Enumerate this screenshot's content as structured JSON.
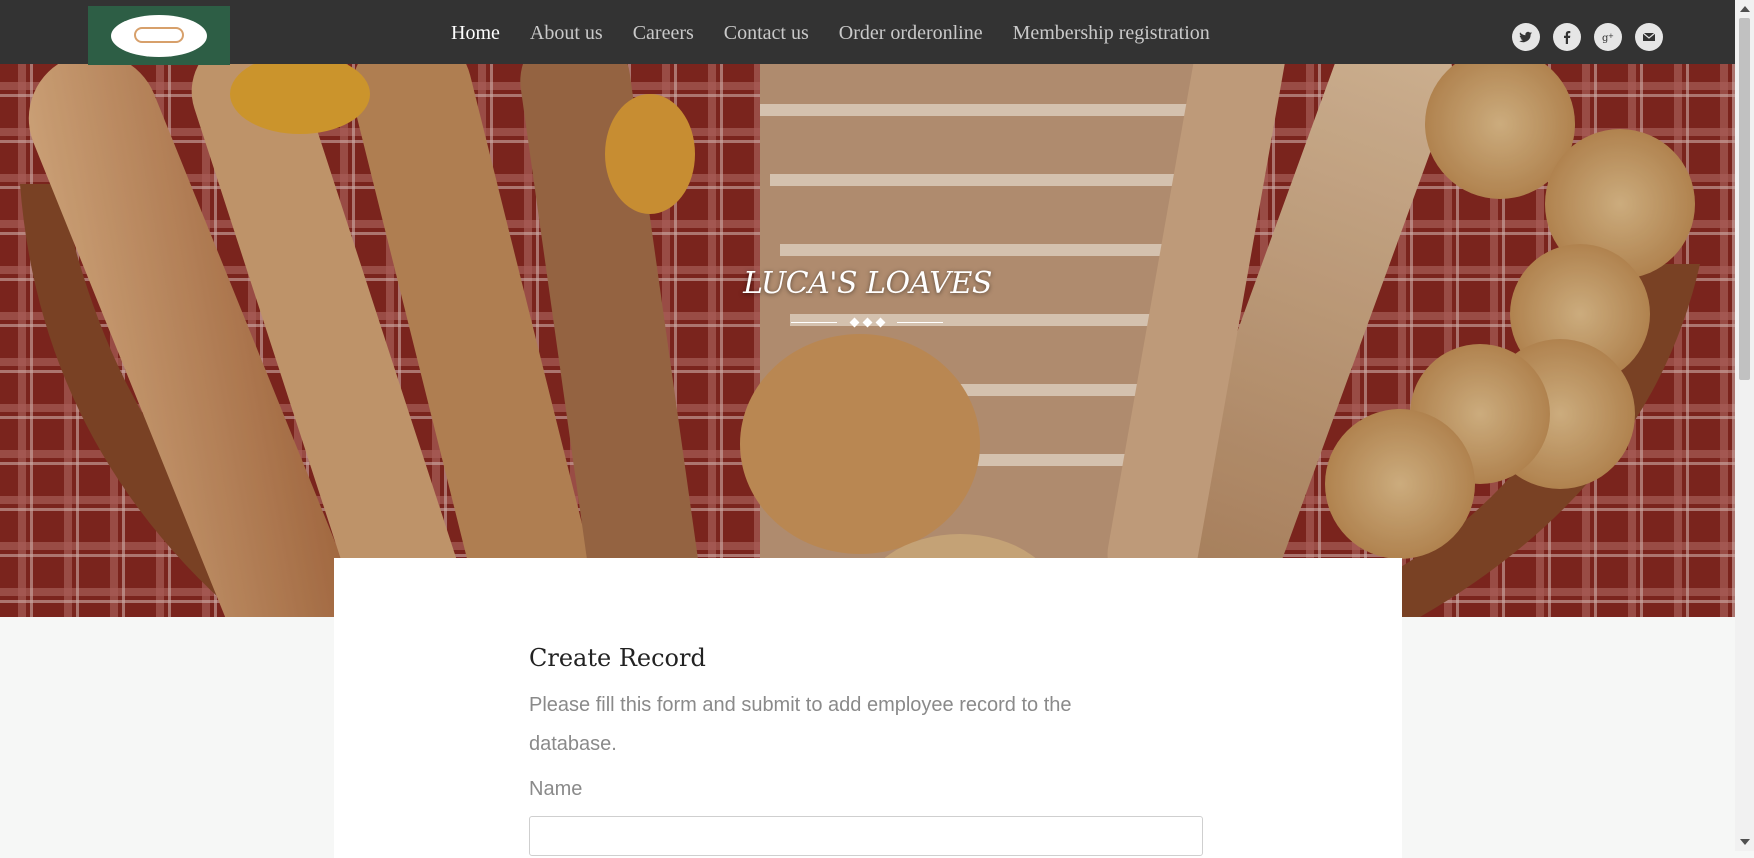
{
  "nav": {
    "items": [
      {
        "label": "Home",
        "active": true
      },
      {
        "label": "About us",
        "active": false
      },
      {
        "label": "Careers",
        "active": false
      },
      {
        "label": "Contact us",
        "active": false
      },
      {
        "label": "Order orderonline",
        "active": false
      },
      {
        "label": "Membership registration",
        "active": false
      }
    ],
    "social_icons": [
      "twitter-icon",
      "facebook-icon",
      "google-plus-icon",
      "email-icon"
    ]
  },
  "hero": {
    "title": "LUCA'S LOAVES"
  },
  "form": {
    "title": "Create Record",
    "description": "Please fill this form and submit to add employee record to the database.",
    "fields": [
      {
        "label": "Name",
        "value": "",
        "placeholder": ""
      }
    ]
  },
  "colors": {
    "nav_bg": "#333333",
    "logo_bg": "#2d5e45",
    "page_bg": "#f6f7f6"
  }
}
